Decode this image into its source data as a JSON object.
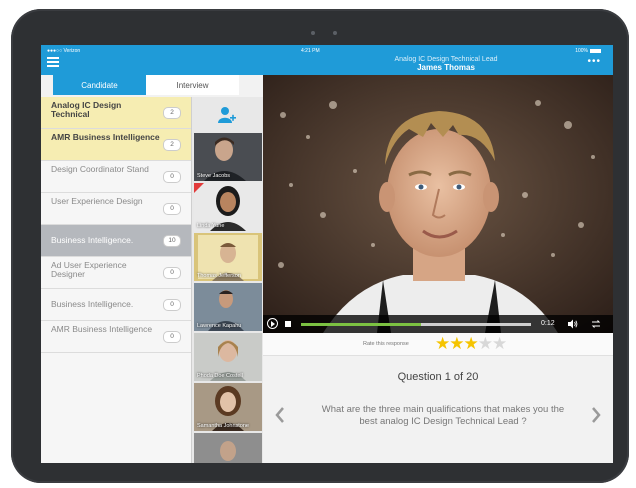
{
  "status": {
    "carrier": "●●●○○ Verizon",
    "time": "4:21 PM",
    "battery": "100%"
  },
  "header": {
    "title": "Analog IC Design Technical Lead",
    "subtitle": "James Thomas",
    "more": "•••"
  },
  "tabs": [
    {
      "label": "Candidate"
    },
    {
      "label": "Interview"
    }
  ],
  "jobs": [
    {
      "label": "Analog IC Design Technical",
      "count": "2"
    },
    {
      "label": "AMR Business Intelligence",
      "count": "2"
    },
    {
      "label": "Design Coordinator Stand",
      "count": "0"
    },
    {
      "label": "User Experience Design",
      "count": "0"
    },
    {
      "label": "Business Intelligence.",
      "count": "10"
    },
    {
      "label": "Ad User Experience Designer",
      "count": "0"
    },
    {
      "label": "Business Intelligence.",
      "count": "0"
    },
    {
      "label": "AMR Business Intelligence",
      "count": "0"
    }
  ],
  "candidates": [
    {
      "name": "Steve Jacobs"
    },
    {
      "name": "Linda Yune"
    },
    {
      "name": "Thomas Jefferson"
    },
    {
      "name": "Lawrence Kapahu"
    },
    {
      "name": "Phoda Doe Costell"
    },
    {
      "name": "Samantha Johnstone"
    }
  ],
  "player": {
    "time": "0:12",
    "progress": 0.52
  },
  "rating": {
    "label": "Rate this response",
    "value": 3,
    "max": 5
  },
  "question": {
    "number": "Question 1 of 20",
    "text": "What are the three main qualifications that makes you the best analog IC Design Technical Lead ?"
  },
  "colors": {
    "accent": "#1f9bd8",
    "highlight": "#f6edb2",
    "star": "#f5c400",
    "progress": "#7cc242"
  }
}
